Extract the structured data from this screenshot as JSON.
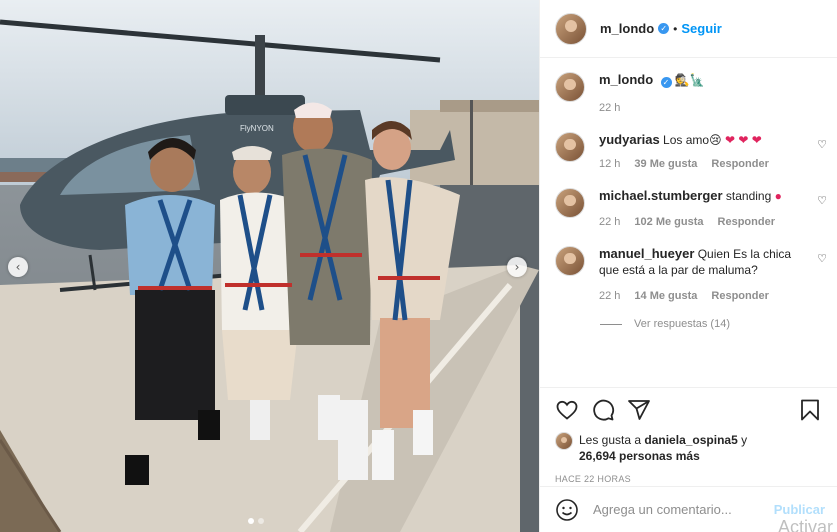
{
  "post": {
    "username": "m_londo",
    "follow_label": "Seguir",
    "caption_emoji": "🕵️🗽"
  },
  "comments": [
    {
      "username": "m_londo",
      "text": "🕵️🗽",
      "time": "22 h"
    },
    {
      "username": "yudyarias",
      "text": "Los amo😢",
      "time": "12 h",
      "likes": "39 Me gusta",
      "reply": "Responder"
    },
    {
      "username": "michael.stumberger",
      "text": "standing",
      "time": "22 h",
      "likes": "102 Me gusta",
      "reply": "Responder"
    },
    {
      "username": "manuel_hueyer",
      "text": "Quien Es la chica que está a la par de maluma?",
      "time": "22 h",
      "likes": "14 Me gusta",
      "reply": "Responder"
    }
  ],
  "view_replies": "Ver respuestas (14)",
  "likes_text": {
    "prefix": "Les gusta a ",
    "user": "daniela_ospina5",
    "mid": " y",
    "count": "26,694 personas más"
  },
  "timestamp": "HACE 22 HORAS",
  "comment_input": {
    "placeholder": "Agrega un comentario...",
    "post_label": "Publicar"
  },
  "helicopter_text": "FlyNYON",
  "overlay_text": "Activar",
  "icons": [
    "heart-icon",
    "comment-icon",
    "share-icon",
    "bookmark-icon",
    "emoji-icon",
    "verified-icon"
  ],
  "colors": {
    "accent": "#0095f6",
    "verified": "#3897f0",
    "heart": "#e0245e"
  }
}
